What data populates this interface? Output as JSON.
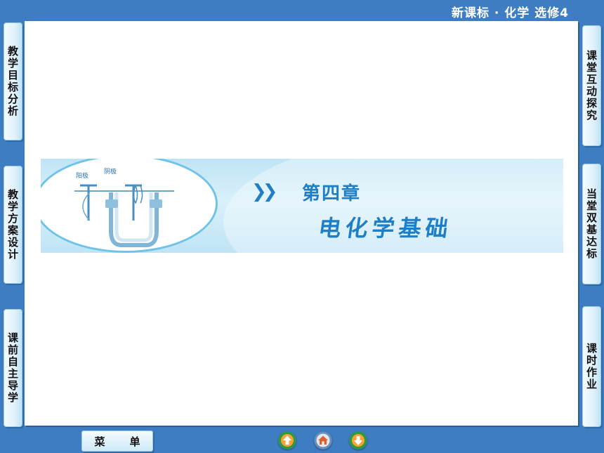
{
  "header": {
    "title": "新课标 · 化学  选修4"
  },
  "left_nav": [
    {
      "label": "教学目标分析"
    },
    {
      "label": "教学方案设计"
    },
    {
      "label": "课前自主导学"
    }
  ],
  "right_nav": [
    {
      "label": "课堂互动探究"
    },
    {
      "label": "当堂双基达标"
    },
    {
      "label": "课时作业"
    }
  ],
  "banner": {
    "chapter": "第四章",
    "subtitle": "电化学基础",
    "figure_labels": {
      "anode": "阳极",
      "cathode": "阴极"
    }
  },
  "bottom": {
    "menu_left": "菜",
    "menu_right": "单"
  },
  "icons": [
    "up-arrow-icon",
    "home-icon",
    "down-arrow-icon",
    "chevron-double-right-icon"
  ],
  "colors": {
    "background": "#3f7dc2",
    "accent": "#1f7fc6",
    "panel": "#ffffff"
  }
}
